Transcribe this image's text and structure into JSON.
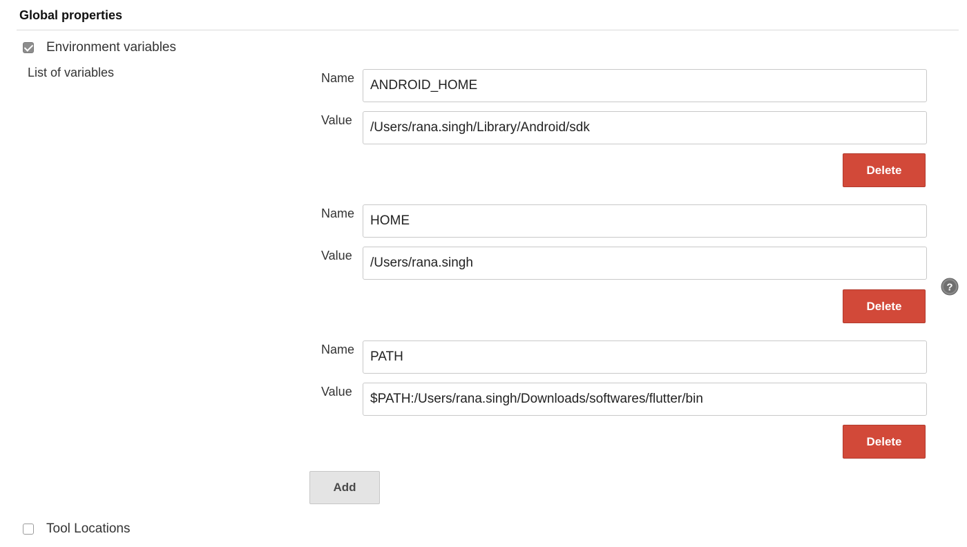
{
  "section": {
    "title": "Global properties"
  },
  "env_vars": {
    "checkbox_label": "Environment variables",
    "checked": true,
    "list_label": "List of variables",
    "name_label": "Name",
    "value_label": "Value",
    "delete_label": "Delete",
    "add_label": "Add",
    "variables": [
      {
        "name": "ANDROID_HOME",
        "value": "/Users/rana.singh/Library/Android/sdk"
      },
      {
        "name": "HOME",
        "value": "/Users/rana.singh"
      },
      {
        "name": "PATH",
        "value": "$PATH:/Users/rana.singh/Downloads/softwares/flutter/bin"
      }
    ]
  },
  "tool_locations": {
    "checkbox_label": "Tool Locations",
    "checked": false
  },
  "icons": {
    "help": "help-icon"
  },
  "colors": {
    "delete_button": "#d24939",
    "add_button": "#e4e4e4",
    "checkbox_checked": "#8d8d8d"
  }
}
